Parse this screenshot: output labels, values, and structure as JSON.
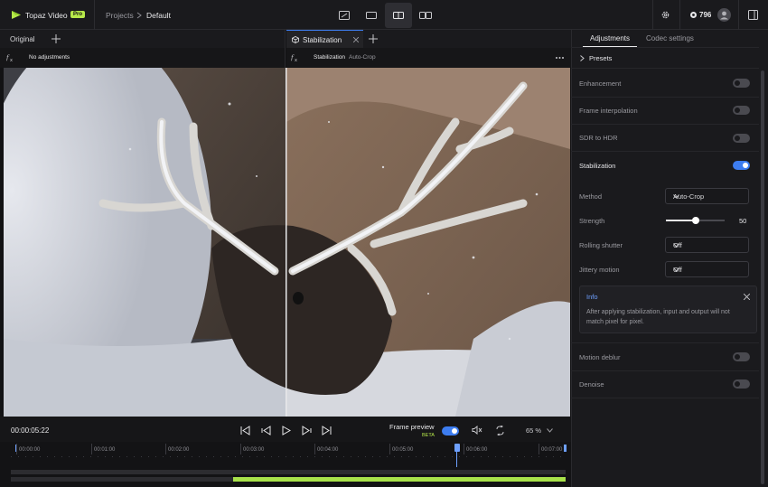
{
  "app": {
    "name": "Topaz Video",
    "badge": "Pro"
  },
  "breadcrumb": {
    "parent": "Projects",
    "current": "Default"
  },
  "credits": {
    "count": "796"
  },
  "tabs": {
    "left": "Original",
    "right": "Stabilization"
  },
  "viewer_left": {
    "info": "No adjustments"
  },
  "viewer_right": {
    "label": "Stabilization",
    "detail": "Auto-Crop"
  },
  "controls": {
    "timecode": "00:00:05:22",
    "frame_preview": "Frame preview",
    "beta": "BETA",
    "zoom": "65 %"
  },
  "timeline": {
    "ticks": [
      "00:00:00",
      "00:01:00",
      "00:02:00",
      "00:03:00",
      "00:04:00",
      "00:05:00",
      "00:06:00",
      "00:07:00"
    ],
    "playhead_fraction": 0.81,
    "track_fill_start": 0.41
  },
  "panel": {
    "tabs": {
      "adjustments": "Adjustments",
      "codec": "Codec settings"
    },
    "presets": "Presets",
    "enhancement": "Enhancement",
    "frame_interpolation": "Frame interpolation",
    "sdr_to_hdr": "SDR to HDR",
    "stabilization": "Stabilization",
    "method_label": "Method",
    "method_value": "Auto-Crop",
    "strength_label": "Strength",
    "strength_value": "50",
    "rolling_label": "Rolling shutter",
    "rolling_value": "Off",
    "jittery_label": "Jittery motion",
    "jittery_value": "Off",
    "info_title": "Info",
    "info_text": "After applying stabilization, input and output will not match pixel for pixel.",
    "motion_deblur": "Motion deblur",
    "denoise": "Denoise"
  },
  "toggles": {
    "enhancement": false,
    "frame_interpolation": false,
    "sdr_to_hdr": false,
    "stabilization": true,
    "motion_deblur": false,
    "denoise": false,
    "frame_preview": true
  },
  "colors": {
    "accent": "#3d7df0",
    "brand": "#b6e84a"
  }
}
